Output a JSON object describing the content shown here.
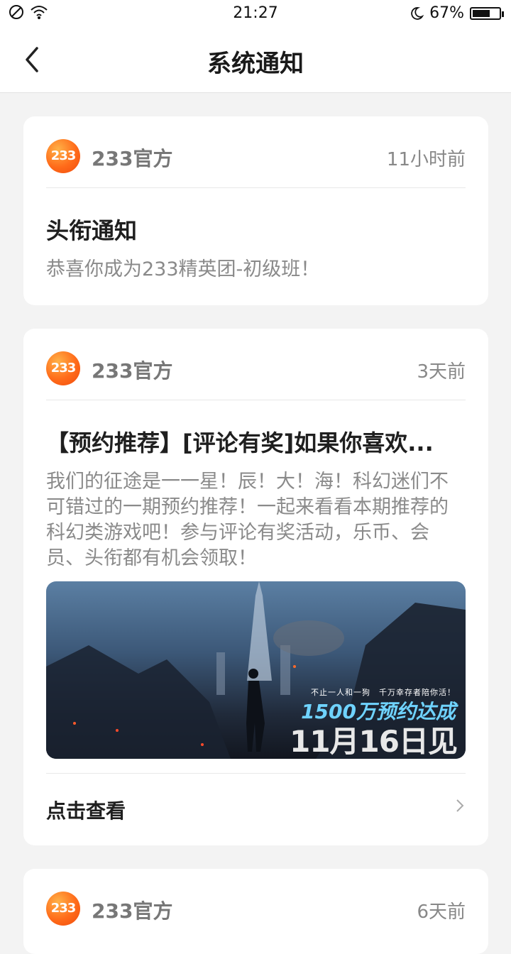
{
  "status_bar": {
    "time": "21:27",
    "battery": "67%",
    "battery_level": 0.67
  },
  "header": {
    "title": "系统通知"
  },
  "notifications": [
    {
      "sender": "233官方",
      "logo": "233",
      "time": "11小时前",
      "title": "头衔通知",
      "body": "恭喜你成为233精英团-初级班！"
    },
    {
      "sender": "233官方",
      "logo": "233",
      "time": "3天前",
      "title": "【预约推荐】[评论有奖]如果你喜欢...",
      "body": "我们的征途是一一星！辰！大！海！科幻迷们不可错过的一期预约推荐！一起来看看本期推荐的科幻类游戏吧！参与评论有奖活动，乐币、会员、头衔都有机会领取！",
      "banner": {
        "subtitle": "不止一人和一狗　千万幸存者陪你活！",
        "headline": "1500万预约达成",
        "date": "11月16日见"
      },
      "action": "点击查看"
    },
    {
      "sender": "233官方",
      "logo": "233",
      "time": "6天前"
    }
  ]
}
